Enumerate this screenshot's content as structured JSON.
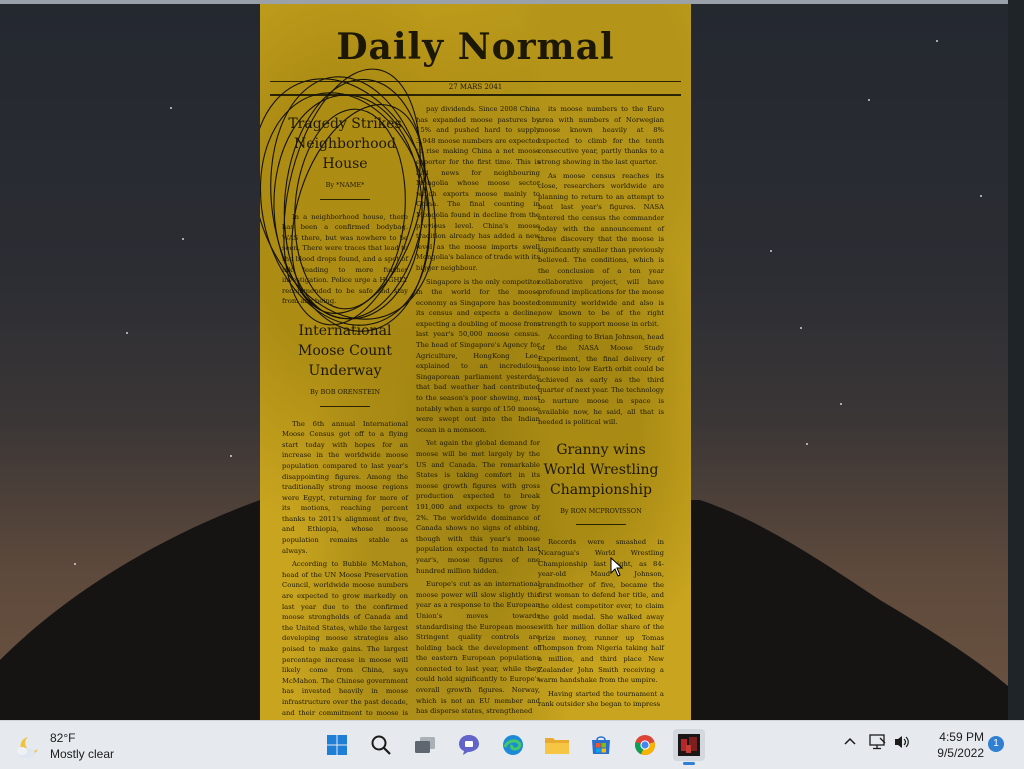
{
  "newspaper": {
    "masthead": "Daily Normal",
    "dateline": "27 MARS 2041",
    "articles": [
      {
        "headline": "Tragedy Strikes Neighborhood House",
        "byline": "By *NAME*",
        "body": [
          "In a neighborhood house, there has been a confirmed bodybag. WAS there, but was nowhere to be seen. There were traces that lead to the blood drops found, and a spot of ink leading to more further investigation. Police urge a HIGHLY recommended to be safe and stay from any being."
        ]
      },
      {
        "headline": "International Moose Count Underway",
        "byline": "By BOB ORENSTEIN",
        "body": [
          "The 6th annual International Moose Census got off to a flying start today with hopes for an increase in the worldwide moose population compared to last year's disappointing figures. Among the traditionally strong moose regions were Egypt, returning for more of its motions, reaching percent thanks to 2011's alignment of five, and Ethiopia, whose moose population remains stable as always.",
          "According to Bubble McMahon, head of the UN Moose Preservation Council, worldwide moose numbers are expected to grow markedly on last year due to the confirmed moose strongholds of Canada and the United States, while the largest developing moose strategies also poised to make gains. The largest percentage increase in moose will likely come from China, says McMahon. The Chinese government has invested heavily in moose infrastructure over the past decade, and their commitment to moose is now beginning to"
        ]
      },
      {
        "headline": "",
        "byline": "",
        "body": [
          "pay dividends. Since 2008 China has expanded moose pastures by 15% and pushed hard to supply 3,948 moose numbers are expected to rise making China a net moose exporter for the first time. This is bad news for neighbouring Mongolia whose moose sector which exports moose mainly to China. The final counting in Mongolia found in decline from the previous level. China's moose tradition already has added a new level as the moose imports swell Mongolia's balance of trade with its bigger neighbour.",
          "Singapore is the only competitor in the world for the moose economy as Singapore has boosted its census and expects a decline, expecting a doubling of moose from last year's 50,000 moose census. The head of Singapore's Agency for Agriculture, HongKong Lee, explained to an incredulous Singaporean parliament yesterday that bad weather had contributed to the season's poor showing, most notably when a surge of 150 moose were swept out into the Indian ocean in a monsoon.",
          "Yet again the global demand for moose will be met largely by the US and Canada. The remarkable States is taking comfort in its moose growth figures with gross production expected to break 191,000 and expects to grow by 2%. The worldwide dominance of Canada shows no signs of ebbing, though with this year's moose population expected to match last year's, moose figures of one hundred million hidden.",
          "Europe's cut as an international moose power will slow slightly this year as a response to the European Union's moves towards standardising the European moose. Stringent quality controls are holding back the development of the eastern European populations connected to last year, while they could hold significantly to Europe's overall growth figures. Norway, which is not an EU member and has disperse states, strengthened"
        ]
      },
      {
        "headline": "",
        "byline": "",
        "body": [
          "its moose numbers to the Euro area with numbers of Norwegian moose known heavily at 8% expected to climb for the tenth consecutive year, partly thanks to a strong showing in the last quarter.",
          "As moose census reaches its close, researchers worldwide are planning to return to an attempt to beat last year's figures. NASA entered the census the commander today with the announcement of three discovery that the moose is significantly smaller than previously believed. The conditions, which is the conclusion of a ten year collaborative project, will have profound implications for the moose community worldwide and also is now known to be of the right strength to support moose in orbit.",
          "According to Brian Johnson, head of the NASA Moose Study Experiment, the final delivery of moose into low Earth orbit could be achieved as early as the third quarter of next year. The technology to nurture moose in space is available now, he said, all that is needed is political will."
        ]
      },
      {
        "headline": "Granny wins World Wrestling Championship",
        "byline": "By RON MCPROVISSON",
        "body": [
          "Records were smashed in Nicaragua's World Wrestling Championship last night, as 84-year-old Maud Johnson, grandmother of five, became the first woman to defend her title, and the oldest competitor ever, to claim the gold medal. She walked away with her million dollar share of the prize money, runner up Tomas Thompson from Nigeria taking half a million, and third place New Zealander John Smith receiving a warm handshake from the umpire.",
          "Having started the tournament a rank outsider she began to impress"
        ]
      }
    ]
  },
  "taskbar": {
    "weather": {
      "temperature": "82°F",
      "condition": "Mostly clear",
      "icon": "moon-cloud-icon"
    },
    "apps": [
      {
        "name": "start",
        "icon": "windows-logo-icon"
      },
      {
        "name": "search",
        "icon": "search-icon"
      },
      {
        "name": "task-view",
        "icon": "task-view-icon"
      },
      {
        "name": "chat",
        "icon": "teams-chat-icon"
      },
      {
        "name": "edge",
        "icon": "edge-icon"
      },
      {
        "name": "file-explorer",
        "icon": "folder-icon"
      },
      {
        "name": "store",
        "icon": "store-icon"
      },
      {
        "name": "chrome",
        "icon": "chrome-icon"
      },
      {
        "name": "game",
        "icon": "game-app-icon"
      }
    ],
    "clock": {
      "time": "4:59 PM",
      "date": "9/5/2022"
    },
    "notification_count": "1",
    "colors": {
      "accent": "#2f7fd3",
      "paper": "#c9a51f",
      "taskbar": "#e6eaee"
    }
  }
}
